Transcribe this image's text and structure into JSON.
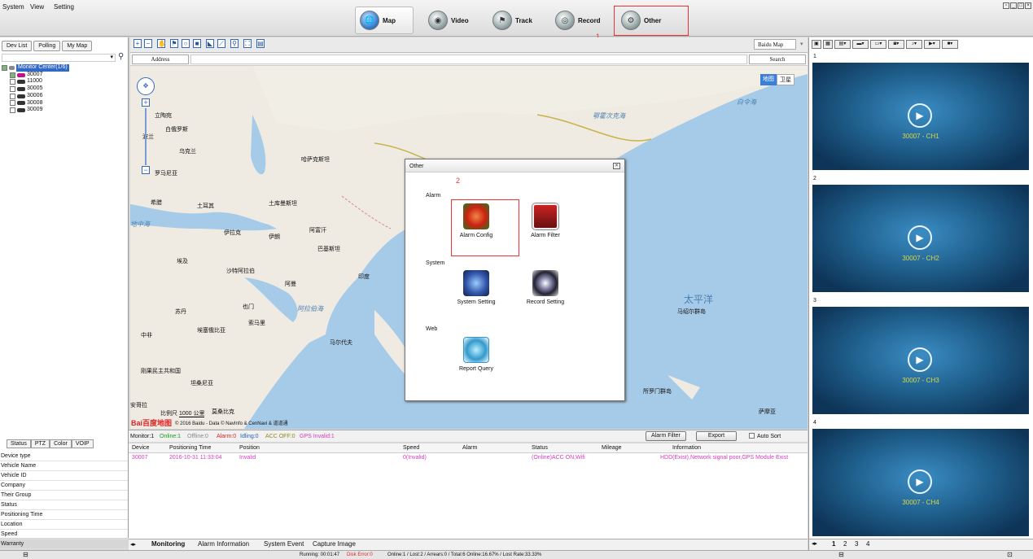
{
  "menu": {
    "system": "System",
    "view": "View",
    "setting": "Setting"
  },
  "toolbar": {
    "map": "Map",
    "video": "Video",
    "track": "Track",
    "record": "Record",
    "other": "Other",
    "annotation_1": "1"
  },
  "left": {
    "tabs": [
      "Dev List",
      "Polling",
      "My Map"
    ],
    "tree": {
      "root": "Monitor Center(1/6)",
      "devices": [
        "30007",
        "11000",
        "30005",
        "30006",
        "30008",
        "30009"
      ]
    },
    "bottom_tabs": [
      "Status",
      "PTZ",
      "Color",
      "VOIP"
    ],
    "props": [
      "Device type",
      "Vehicle Name",
      "Vehicle ID",
      "Company",
      "Their Group",
      "Status",
      "Positioning Time",
      "Location",
      "Speed",
      "Warranty"
    ]
  },
  "map": {
    "map_type": "Baidu Map",
    "address_label": "Address",
    "search_label": "Search",
    "mode_map": "地图",
    "mode_sat": "卫星",
    "labels": [
      "俄罗斯",
      "白俄罗斯",
      "乌克兰",
      "哈萨克斯坦",
      "罗马尼亚",
      "希腊",
      "土耳其",
      "土库曼斯坦",
      "伊拉克",
      "伊朗",
      "阿富汗",
      "巴基斯坦",
      "印度",
      "埃及",
      "沙特阿拉伯",
      "阿曼",
      "苏丹",
      "也门",
      "索马里",
      "埃塞俄比亚",
      "中非",
      "刚果民主共和国",
      "坦桑尼亚",
      "安哥拉",
      "莫桑比克",
      "马尔代夫",
      "阿拉伯海",
      "地中海",
      "鄂霍次克海",
      "白令海",
      "太平洋",
      "马绍尔群岛",
      "所罗门群岛",
      "萨摩亚",
      "波兰",
      "立陶宛"
    ],
    "scale": "1000 公里",
    "copyright": "© 2016 Baidu - Data © NavInfo & CenNavi & 道道通",
    "logo": "Bai百度地图",
    "scale_prefix": "比例尺"
  },
  "monitor": {
    "monitor": "Monitor:1",
    "online": "Online:1",
    "offline": "Offline:0",
    "alarm": "Alarm:0",
    "idling": "Idling:0",
    "acc": "ACC OFF:0",
    "gps": "GPS Invalid:1",
    "alarm_filter": "Alarm Filter",
    "export": "Export",
    "auto_sort": "Auto Sort"
  },
  "grid": {
    "headers": [
      "Device",
      "Positioning Time",
      "Position",
      "Speed",
      "Alarm",
      "Status",
      "Mileage",
      "Information"
    ],
    "row": [
      "30007",
      "2016-10-31 11:33:04",
      "Invalid",
      "0(Invalid)",
      "",
      "(Online)ACC ON,Wifi",
      "",
      "HDD(Exist),Network signal poor,GPS Module Exist"
    ]
  },
  "bottom_tabs": [
    "Monitoring",
    "Alarm Information",
    "System Event",
    "Capture Image"
  ],
  "videos": [
    {
      "num": "1",
      "label": "30007 - CH1"
    },
    {
      "num": "2",
      "label": "30007 - CH2"
    },
    {
      "num": "3",
      "label": "30007 - CH3"
    },
    {
      "num": "4",
      "label": "30007 - CH4"
    }
  ],
  "pages": [
    "1",
    "2",
    "3",
    "4"
  ],
  "dialog": {
    "title": "Other",
    "annotation_2": "2",
    "sec_alarm": "Alarm",
    "sec_system": "System",
    "sec_web": "Web",
    "items": {
      "alarm_config": "Alarm Config",
      "alarm_filter": "Alarm Filter",
      "system_setting": "System Setting",
      "record_setting": "Record Setting",
      "report_query": "Report Query"
    }
  },
  "status": {
    "running": "Running: 00:01:47",
    "disk": "Disk Error:0",
    "summary": "Online:1 / Lost:2 / Arrears:0 / Total:6   Online:16.67% / Lost Rate:33.33%"
  }
}
